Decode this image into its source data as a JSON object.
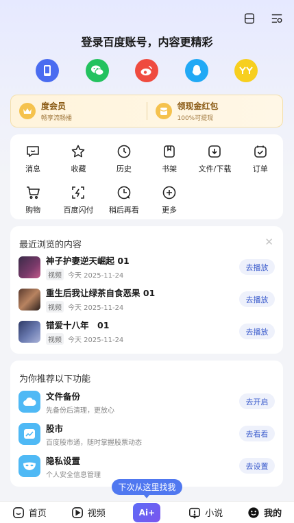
{
  "login": {
    "title": "登录百度账号，内容更精彩"
  },
  "vip": {
    "left": {
      "title": "度会员",
      "sub": "畅享流畅播"
    },
    "right": {
      "title": "领现金红包",
      "sub": "100%可提现"
    }
  },
  "functions": [
    {
      "label": "消息",
      "icon": "message-icon"
    },
    {
      "label": "收藏",
      "icon": "star-icon"
    },
    {
      "label": "历史",
      "icon": "clock-icon"
    },
    {
      "label": "书架",
      "icon": "bookmark-icon"
    },
    {
      "label": "文件/下载",
      "icon": "download-icon"
    },
    {
      "label": "订单",
      "icon": "order-icon"
    },
    {
      "label": "购物",
      "icon": "cart-icon"
    },
    {
      "label": "百度闪付",
      "icon": "scan-pay-icon"
    },
    {
      "label": "稍后再看",
      "icon": "watch-later-icon"
    },
    {
      "label": "更多",
      "icon": "plus-icon"
    }
  ],
  "recent": {
    "title": "最近浏览的内容",
    "items": [
      {
        "title": "神子护妻逆天崛起 01",
        "tag": "视频",
        "meta": "今天  2025-11-24",
        "action": "去播放"
      },
      {
        "title": "重生后我让绿茶自食恶果 01",
        "tag": "视频",
        "meta": "今天  2025-11-24",
        "action": "去播放"
      },
      {
        "title": "错爱十八年　01",
        "tag": "视频",
        "meta": "今天  2025-11-24",
        "action": "去播放"
      }
    ]
  },
  "recommend": {
    "title": "为你推荐以下功能",
    "items": [
      {
        "title": "文件备份",
        "sub": "先备份后清理，更放心",
        "action": "去开启"
      },
      {
        "title": "股市",
        "sub": "百度股市通，随时掌握股票动态",
        "action": "去看看"
      },
      {
        "title": "隐私设置",
        "sub": "个人安全信息管理",
        "action": "去设置"
      }
    ]
  },
  "tooltip": "下次从这里找我",
  "tabs": {
    "home": "首页",
    "video": "视频",
    "ai": "Ai+",
    "novel": "小说",
    "mine": "我的"
  },
  "colors": {
    "accent": "#5078f0",
    "pill_text": "#3a5bcc",
    "vip_text": "#8a5a14"
  }
}
